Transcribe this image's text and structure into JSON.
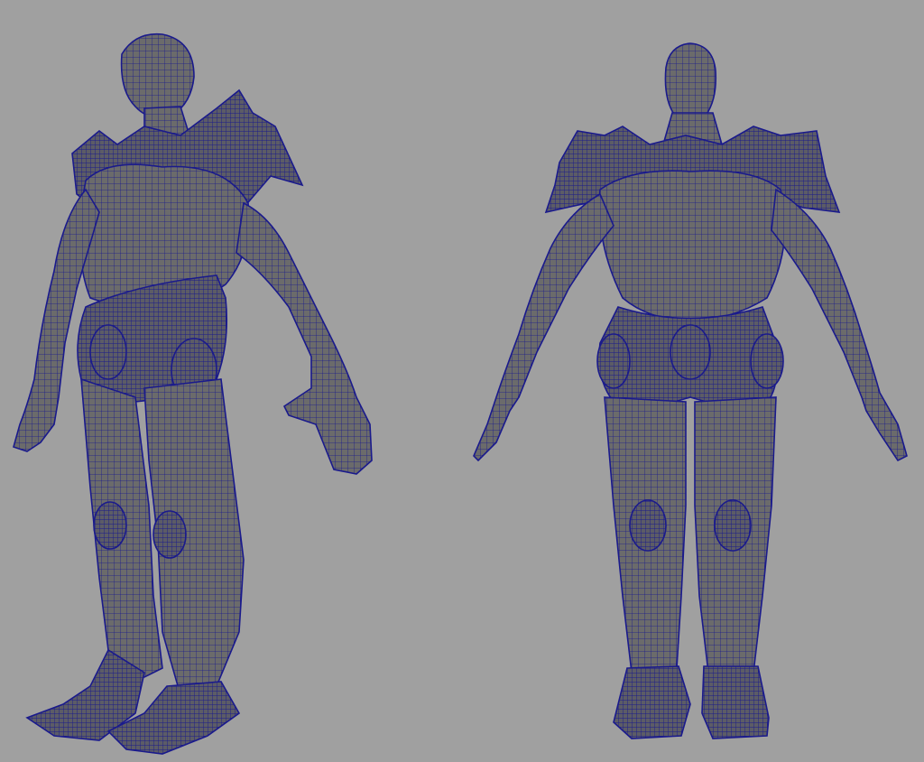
{
  "viewport": {
    "background": "#a0a0a0",
    "mesh_fill": "#6b6b6b",
    "wire_color": "#1a1a8c"
  },
  "models": [
    {
      "view": "perspective",
      "subject": "armored-humanoid-wireframe"
    },
    {
      "view": "front",
      "subject": "armored-humanoid-wireframe"
    }
  ]
}
